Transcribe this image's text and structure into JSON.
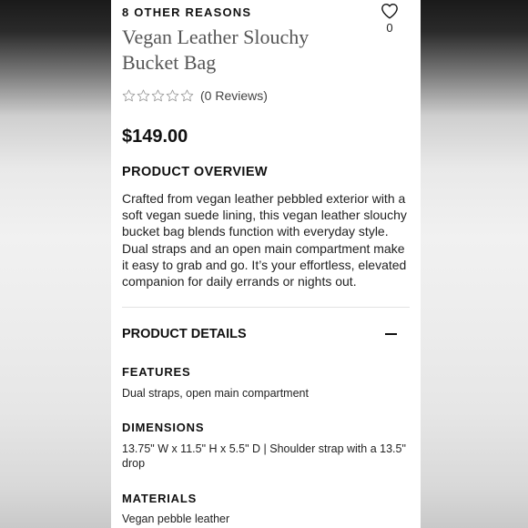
{
  "brand": "8 OTHER REASONS",
  "favorites": {
    "count": "0",
    "icon": "heart-outline-icon"
  },
  "product": {
    "title": "Vegan Leather Slouchy Bucket Bag",
    "rating": {
      "stars_filled": 0,
      "stars_total": 5,
      "reviews_label": "(0 Reviews)"
    },
    "price": "$149.00"
  },
  "overview": {
    "heading": "PRODUCT OVERVIEW",
    "text": "Crafted from vegan leather pebbled exterior with a soft vegan suede lining, this vegan leather slouchy bucket bag blends function with everyday style. Dual straps and an open main compartment make it easy to grab and go. It’s your effortless, elevated companion for daily errands or nights out."
  },
  "details": {
    "heading": "PRODUCT DETAILS",
    "toggle_icon": "minus-icon",
    "features": {
      "heading": "FEATURES",
      "text": "Dual straps, open main compartment"
    },
    "dimensions": {
      "heading": "DIMENSIONS",
      "text": "13.75\" W x 11.5\" H x 5.5\" D | Shoulder strap with a 13.5\" drop"
    },
    "materials": {
      "heading": "MATERIALS",
      "text": "Vegan pebble leather"
    }
  }
}
